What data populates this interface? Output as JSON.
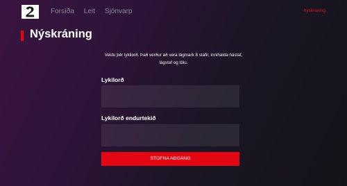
{
  "app": {
    "logo_icon": "channel-2-logo-icon",
    "accent_color": "#e30613"
  },
  "header": {
    "nav": [
      "Forsíða",
      "Leit",
      "Sjónvarp"
    ],
    "signup_link": "nýskráning"
  },
  "page": {
    "title": "Nýskráning"
  },
  "form": {
    "instructions": "Veldu þér lykilorð. Það verður að vera lágmark 8 stafir, innihalda hástaf, lágstaf og tölu.",
    "password_label": "Lykilorð",
    "password_value": "",
    "confirm_label": "Lykilorð endurtekið",
    "confirm_value": "",
    "submit_label": "STOFNA AÐGANG"
  }
}
